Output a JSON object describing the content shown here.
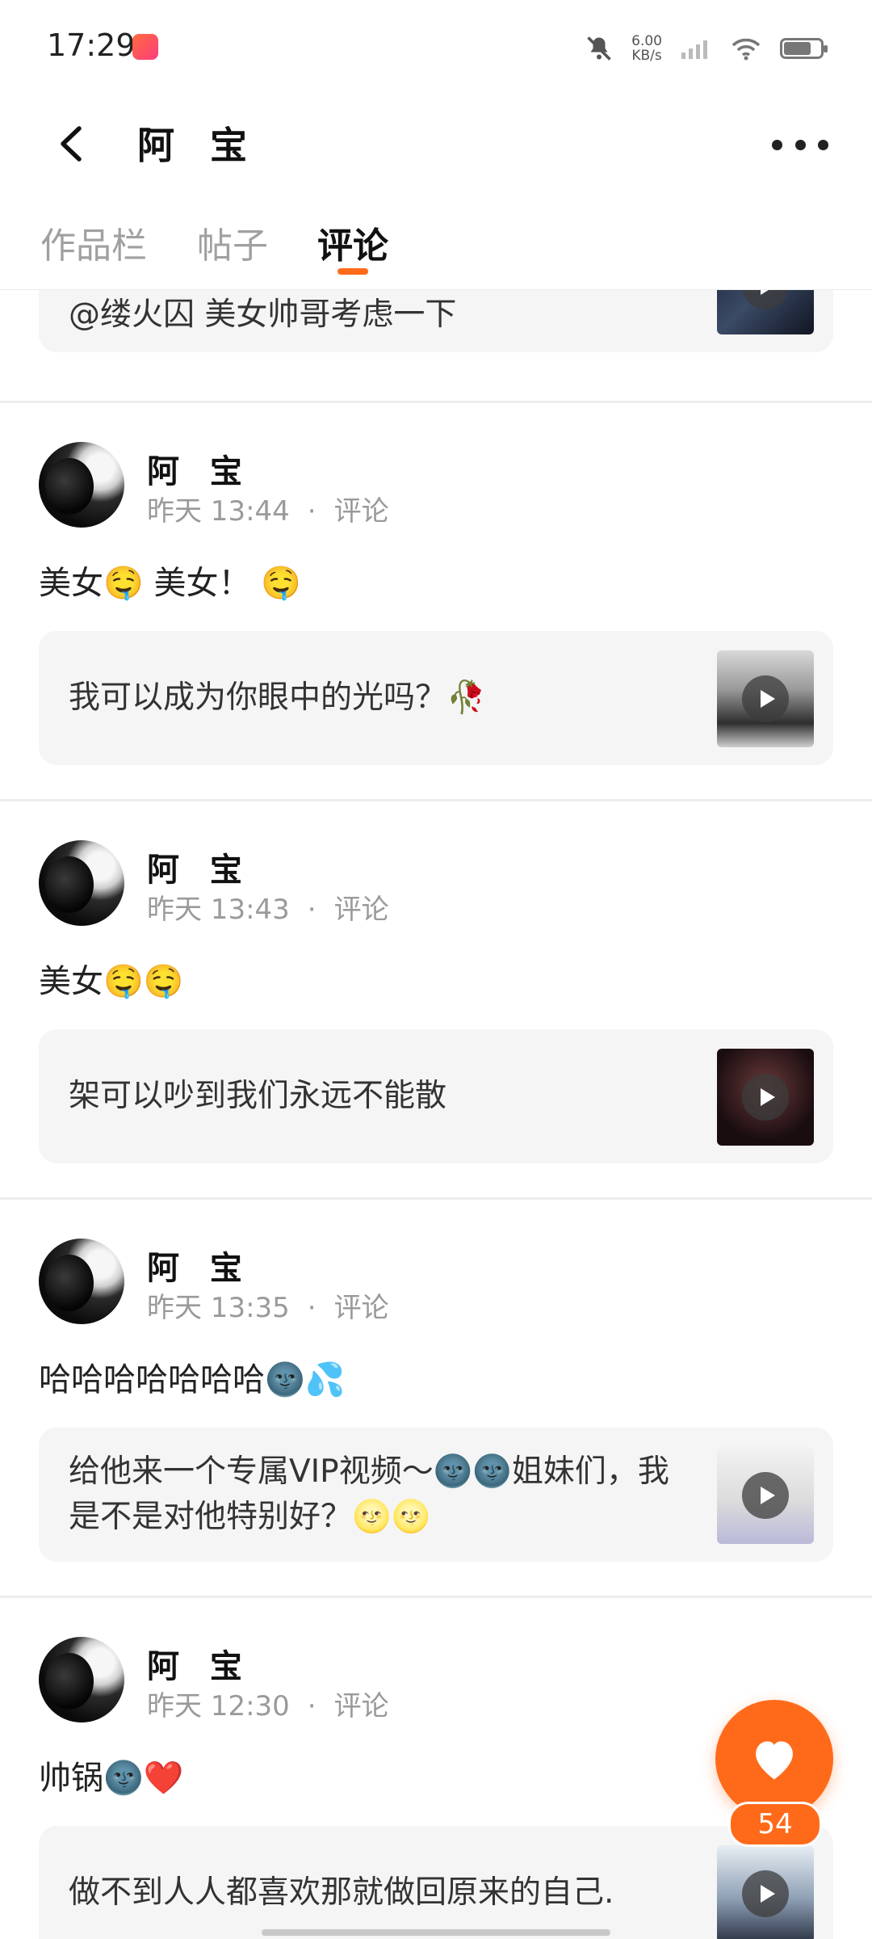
{
  "status_bar": {
    "time": "17:29",
    "net_speed_value": "6.00",
    "net_speed_unit": "KB/s",
    "battery_level": 0.75
  },
  "header": {
    "title": "阿 宝"
  },
  "tabs": [
    {
      "label": "作品栏",
      "active": false
    },
    {
      "label": "帖子",
      "active": false
    },
    {
      "label": "评论",
      "active": true
    }
  ],
  "feed": {
    "partial_card_text": "@缕火囚    美女帅哥考虑一下",
    "posts": [
      {
        "author": "阿 宝",
        "time": "昨天 13:44",
        "type": "评论",
        "comment": "美女🤤 美女！ 🤤",
        "quoted_text": "我可以成为你眼中的光吗？🥀"
      },
      {
        "author": "阿 宝",
        "time": "昨天 13:43",
        "type": "评论",
        "comment": "美女🤤🤤",
        "quoted_text": "架可以吵到我们永远不能散"
      },
      {
        "author": "阿 宝",
        "time": "昨天 13:35",
        "type": "评论",
        "comment": "哈哈哈哈哈哈哈🌚💦",
        "quoted_text": "给他来一个专属VIP视频～🌚🌚姐妹们，我是不是对他特别好？🌝🌝"
      },
      {
        "author": "阿 宝",
        "time": "昨天 12:30",
        "type": "评论",
        "comment": "帅锅🌚❤️",
        "quoted_text": "做不到人人都喜欢那就做回原来的自己."
      }
    ],
    "meta_separator": "·"
  },
  "fab": {
    "like_count": "54",
    "color": "#ff6a1a"
  }
}
